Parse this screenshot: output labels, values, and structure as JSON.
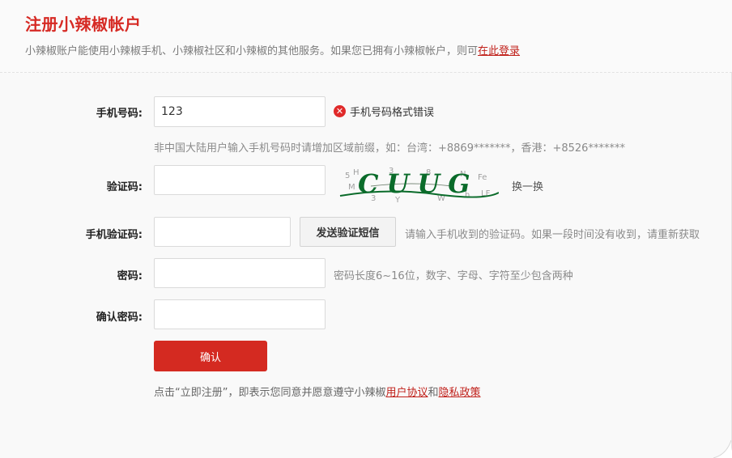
{
  "header": {
    "title": "注册小辣椒帐户",
    "subtitle_text": "小辣椒账户能使用小辣椒手机、小辣椒社区和小辣椒的其他服务。如果您已拥有小辣椒帐户，则可",
    "login_link": "在此登录"
  },
  "form": {
    "phone": {
      "label": "手机号码:",
      "value": "123",
      "error": "手机号码格式错误",
      "hint": "非中国大陆用户输入手机号码时请增加区域前缀，如：台湾：+8869*******，香港：+8526*******"
    },
    "captcha": {
      "label": "验证码:",
      "value": "",
      "image_text": "CUUG",
      "refresh": "换一换"
    },
    "sms": {
      "label": "手机验证码:",
      "value": "",
      "button": "发送验证短信",
      "hint": "请输入手机收到的验证码。如果一段时间没有收到，请重新获取"
    },
    "password": {
      "label": "密码:",
      "value": "",
      "hint": "密码长度6~16位，数字、字母、字符至少包含两种"
    },
    "confirm_password": {
      "label": "确认密码:",
      "value": ""
    },
    "submit": "确认"
  },
  "agreement": {
    "prefix": "点击“立即注册”，即表示您同意并愿意遵守小辣椒",
    "terms": "用户协议",
    "and": "和",
    "privacy": "隐私政策"
  },
  "colors": {
    "brand_red": "#d42a21",
    "error_red": "#e02a2a",
    "captcha_green": "#0a6b2a"
  }
}
